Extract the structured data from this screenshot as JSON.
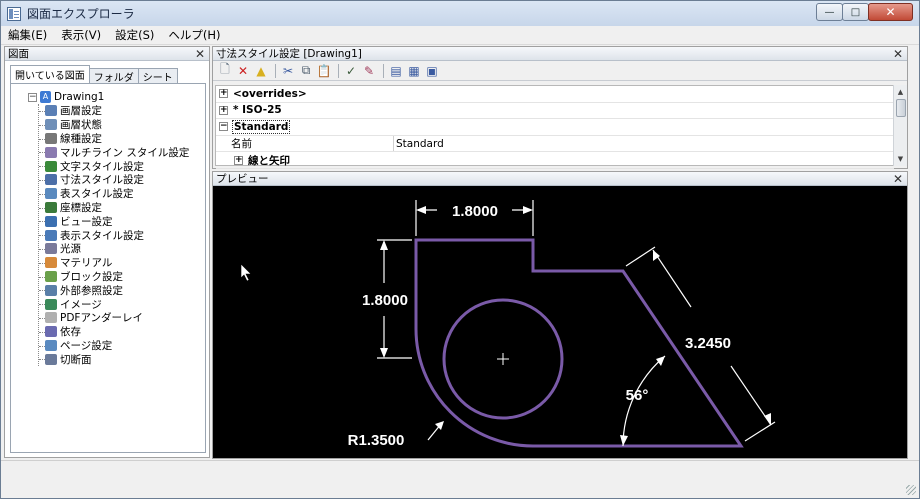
{
  "window": {
    "title": "図面エクスプローラ",
    "controls": {
      "minimize": "—",
      "maximize": "□",
      "close": "✕"
    }
  },
  "menu": [
    "編集(E)",
    "表示(V)",
    "設定(S)",
    "ヘルプ(H)"
  ],
  "left_pane": {
    "title": "図面",
    "close": "✕",
    "tabs": [
      "開いている図面",
      "フォルダ",
      "シート"
    ],
    "tree": {
      "root": "Drawing1",
      "items": [
        {
          "label": "画層設定",
          "icon": "layer-icon",
          "color": "#5a7fb5"
        },
        {
          "label": "画層状態",
          "icon": "layer-state-icon",
          "color": "#6f8fb8"
        },
        {
          "label": "線種設定",
          "icon": "linetype-icon",
          "color": "#777777"
        },
        {
          "label": "マルチライン スタイル設定",
          "icon": "multiline-icon",
          "color": "#8a7ab0"
        },
        {
          "label": "文字スタイル設定",
          "icon": "text-style-icon",
          "color": "#3a8a3a"
        },
        {
          "label": "寸法スタイル設定",
          "icon": "dim-style-icon",
          "color": "#4c6fa8"
        },
        {
          "label": "表スタイル設定",
          "icon": "table-style-icon",
          "color": "#5a8abf"
        },
        {
          "label": "座標設定",
          "icon": "ucs-icon",
          "color": "#3a7a3a"
        },
        {
          "label": "ビュー設定",
          "icon": "view-icon",
          "color": "#3b6fb0"
        },
        {
          "label": "表示スタイル設定",
          "icon": "visual-style-icon",
          "color": "#4a7ab8"
        },
        {
          "label": "光源",
          "icon": "light-icon",
          "color": "#7a7a9a"
        },
        {
          "label": "マテリアル",
          "icon": "material-icon",
          "color": "#d78a3a"
        },
        {
          "label": "ブロック設定",
          "icon": "block-icon",
          "color": "#6aa04a"
        },
        {
          "label": "外部参照設定",
          "icon": "xref-icon",
          "color": "#5a7fa8"
        },
        {
          "label": "イメージ",
          "icon": "image-icon",
          "color": "#3a8a5a"
        },
        {
          "label": "PDFアンダーレイ",
          "icon": "pdf-icon",
          "color": "#b0b0b0"
        },
        {
          "label": "依存",
          "icon": "dependency-icon",
          "color": "#6a6ab0"
        },
        {
          "label": "ページ設定",
          "icon": "page-setup-icon",
          "color": "#5a8ac0"
        },
        {
          "label": "切断面",
          "icon": "section-icon",
          "color": "#6a7a9a"
        }
      ]
    }
  },
  "style_pane": {
    "title": "寸法スタイル設定 [Drawing1]",
    "close": "✕",
    "toolbar": [
      {
        "icon": "new-icon",
        "glyph": "🗋",
        "color": "#5a6a7a"
      },
      {
        "icon": "delete-icon",
        "glyph": "✕",
        "color": "#cc2020"
      },
      {
        "icon": "purge-icon",
        "glyph": "▲",
        "color": "#d8b020"
      },
      {
        "icon": "cut-icon",
        "glyph": "✂",
        "color": "#3a5aa0"
      },
      {
        "icon": "copy-icon",
        "glyph": "⧉",
        "color": "#4a5a6a"
      },
      {
        "icon": "paste-icon",
        "glyph": "📋",
        "color": "#8a6a3a"
      },
      {
        "icon": "set-current-icon",
        "glyph": "✓",
        "color": "#3a5a3a"
      },
      {
        "icon": "edit-icon",
        "glyph": "✎",
        "color": "#a03a5a"
      },
      {
        "icon": "list-view-icon",
        "glyph": "▤",
        "color": "#3a5aa0"
      },
      {
        "icon": "icon-view-icon",
        "glyph": "▦",
        "color": "#3a5aa0"
      },
      {
        "icon": "detail-view-icon",
        "glyph": "▣",
        "color": "#3a5aa0"
      }
    ],
    "rows": [
      {
        "type": "group",
        "expander": "⊞",
        "label": "<overrides>",
        "bold": true
      },
      {
        "type": "group",
        "expander": "⊞",
        "label": "* ISO-25",
        "bold": true
      },
      {
        "type": "group",
        "expander": "⊟",
        "label": "Standard",
        "bold": true,
        "selected": true
      },
      {
        "type": "prop",
        "name": "名前",
        "value": "Standard"
      },
      {
        "type": "subgroup",
        "expander": "⊞",
        "label": "線と矢印",
        "bold": true
      }
    ]
  },
  "preview": {
    "title": "プレビュー",
    "close": "✕",
    "dims": {
      "top": "1.8000",
      "left": "1.8000",
      "aligned": "3.2450",
      "angle": "56°",
      "radius": "R1.3500"
    },
    "colors": {
      "geometry": "#7a5aa8",
      "dims": "#ffffff",
      "background": "#000000"
    }
  }
}
